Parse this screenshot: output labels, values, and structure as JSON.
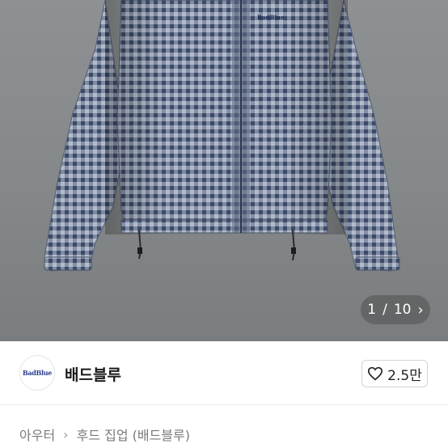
{
  "gallery": {
    "image_alt_icon": "product-photo-jacket",
    "brand_print": "BadBlue",
    "current": "1",
    "separator": "/",
    "total": "10",
    "next_icon": "chevron-right-icon"
  },
  "store": {
    "logo_text": "BadBlue",
    "name": "배드블루",
    "like_count": "2.5만",
    "like_icon": "heart-outline-icon"
  },
  "breadcrumb": {
    "category": "아우터",
    "separator": "›",
    "title": "후드 집업 (배드블루)"
  },
  "colors": {
    "fabric_dark": "#4d5a73",
    "fabric_light": "#aeb6c4",
    "background": "#888b8d"
  }
}
